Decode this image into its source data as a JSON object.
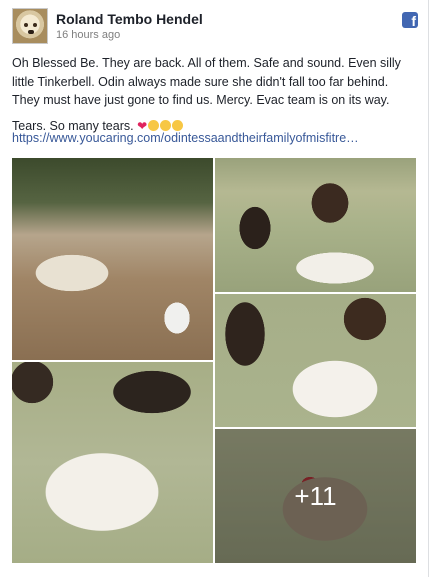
{
  "post": {
    "author": "Roland Tembo Hendel",
    "timestamp": "16 hours ago",
    "paragraph1": "Oh Blessed Be. They are back. All of them. Safe and sound. Even silly little Tinkerbell. Odin always made sure she didn't fall too far behind. They must have just gone to find us. Mercy. Evac team is on its way.",
    "paragraph2": "Tears. So many tears.",
    "link": "https://www.youcaring.com/odintessaandtheirfamilyofmisfitre…",
    "more_photos": "+11"
  },
  "icons": {
    "logo": "facebook-logo-icon",
    "audience": "globe-icon"
  },
  "colors": {
    "brand": "#4267b2",
    "link": "#385898",
    "heart": "#e0245e"
  }
}
